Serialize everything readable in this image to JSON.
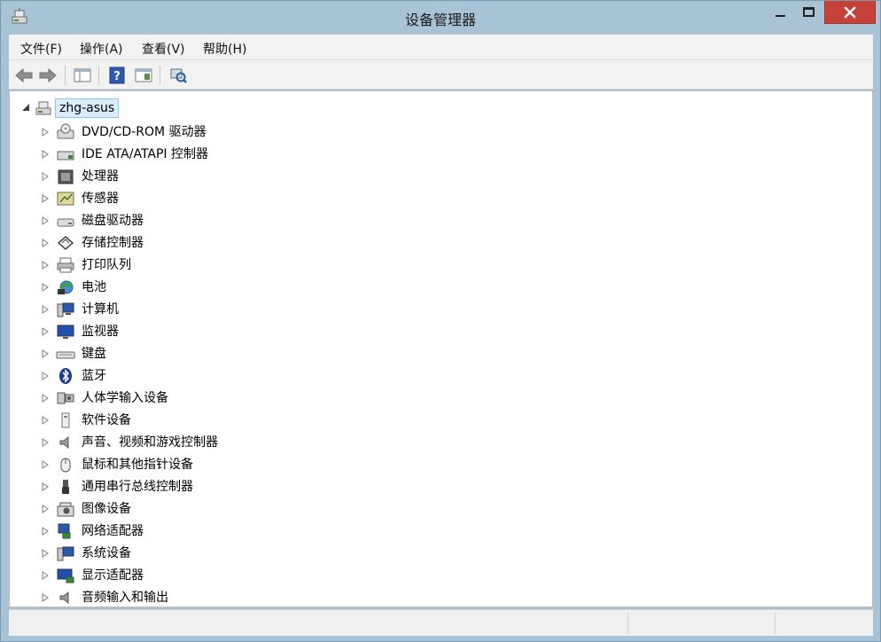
{
  "window": {
    "title": "设备管理器",
    "accent": "#a9c3d6",
    "close_color": "#c7413b"
  },
  "menu": [
    {
      "label": "文件(F)"
    },
    {
      "label": "操作(A)"
    },
    {
      "label": "查看(V)"
    },
    {
      "label": "帮助(H)"
    }
  ],
  "toolbar": {
    "buttons": [
      {
        "icon": "back-arrow-icon"
      },
      {
        "icon": "forward-arrow-icon"
      },
      {
        "icon": "show-hide-console-tree-icon"
      },
      {
        "icon": "help-icon"
      },
      {
        "icon": "properties-icon"
      },
      {
        "icon": "scan-hardware-icon"
      }
    ]
  },
  "tree": {
    "root": {
      "label": "zhg-asus",
      "icon": "computer-network-icon",
      "expanded": true
    },
    "nodes": [
      {
        "label": "DVD/CD-ROM 驱动器",
        "icon": "dvd-drive-icon"
      },
      {
        "label": "IDE ATA/ATAPI 控制器",
        "icon": "ide-controller-icon"
      },
      {
        "label": "处理器",
        "icon": "processor-icon"
      },
      {
        "label": "传感器",
        "icon": "sensor-icon"
      },
      {
        "label": "磁盘驱动器",
        "icon": "disk-drive-icon"
      },
      {
        "label": "存储控制器",
        "icon": "storage-controller-icon"
      },
      {
        "label": "打印队列",
        "icon": "printer-icon"
      },
      {
        "label": "电池",
        "icon": "battery-icon"
      },
      {
        "label": "计算机",
        "icon": "computer-icon"
      },
      {
        "label": "监视器",
        "icon": "monitor-icon"
      },
      {
        "label": "键盘",
        "icon": "keyboard-icon"
      },
      {
        "label": "蓝牙",
        "icon": "bluetooth-icon"
      },
      {
        "label": "人体学输入设备",
        "icon": "hid-icon"
      },
      {
        "label": "软件设备",
        "icon": "software-device-icon"
      },
      {
        "label": "声音、视频和游戏控制器",
        "icon": "speaker-icon"
      },
      {
        "label": "鼠标和其他指针设备",
        "icon": "mouse-icon"
      },
      {
        "label": "通用串行总线控制器",
        "icon": "usb-icon"
      },
      {
        "label": "图像设备",
        "icon": "camera-icon"
      },
      {
        "label": "网络适配器",
        "icon": "network-adapter-icon"
      },
      {
        "label": "系统设备",
        "icon": "system-device-icon"
      },
      {
        "label": "显示适配器",
        "icon": "display-adapter-icon"
      },
      {
        "label": "音频输入和输出",
        "icon": "audio-io-icon"
      }
    ]
  }
}
